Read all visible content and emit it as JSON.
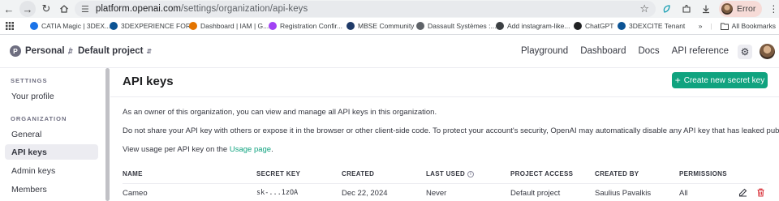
{
  "browser": {
    "url_host": "platform.openai.com",
    "url_path": "/settings/organization/api-keys",
    "profile_status": "Error",
    "bookmarks": [
      {
        "label": "CATIA Magic | 3DEX...",
        "color": "#1a73e8"
      },
      {
        "label": "3DEXPERIENCE FOR...",
        "color": "#0b5394"
      },
      {
        "label": "Dashboard | IAM | G...",
        "color": "#e37400"
      },
      {
        "label": "Registration Confir...",
        "color": "#a142f4"
      },
      {
        "label": "MBSE Community",
        "color": "#1f3a68"
      },
      {
        "label": "Dassault Systèmes :...",
        "color": "#5f6368"
      },
      {
        "label": "Add instagram-like...",
        "color": "#3c4043"
      },
      {
        "label": "ChatGPT",
        "color": "#202123"
      },
      {
        "label": "3DEXCITE Tenant",
        "color": "#0b5394"
      }
    ],
    "all_bookmarks": "All Bookmarks"
  },
  "topnav": {
    "org_initial": "P",
    "org_name": "Personal",
    "project_name": "Default project",
    "links": [
      "Playground",
      "Dashboard",
      "Docs",
      "API reference"
    ]
  },
  "sidebar": {
    "settings_heading": "SETTINGS",
    "settings_items": [
      "Your profile"
    ],
    "org_heading": "ORGANIZATION",
    "org_items": [
      "General",
      "API keys",
      "Admin keys",
      "Members"
    ],
    "active_item": "API keys"
  },
  "main": {
    "title": "API keys",
    "create_button": "Create new secret key",
    "para1": "As an owner of this organization, you can view and manage all API keys in this organization.",
    "para2": "Do not share your API key with others or expose it in the browser or other client-side code. To protect your account's security, OpenAI may automatically disable any API key that has leaked publicly.",
    "para3_prefix": "View usage per API key on the ",
    "para3_link": "Usage page",
    "para3_suffix": ".",
    "table": {
      "headers": [
        "NAME",
        "SECRET KEY",
        "CREATED",
        "LAST USED",
        "PROJECT ACCESS",
        "CREATED BY",
        "PERMISSIONS"
      ],
      "rows": [
        {
          "name": "Cameo",
          "secret": "sk-...1zOA",
          "created": "Dec 22, 2024",
          "last_used": "Never",
          "project_access": "Default project",
          "created_by": "Saulius Pavalkis",
          "permissions": "All"
        }
      ]
    }
  },
  "colors": {
    "accent": "#10a37f",
    "delete": "#d9363e"
  }
}
